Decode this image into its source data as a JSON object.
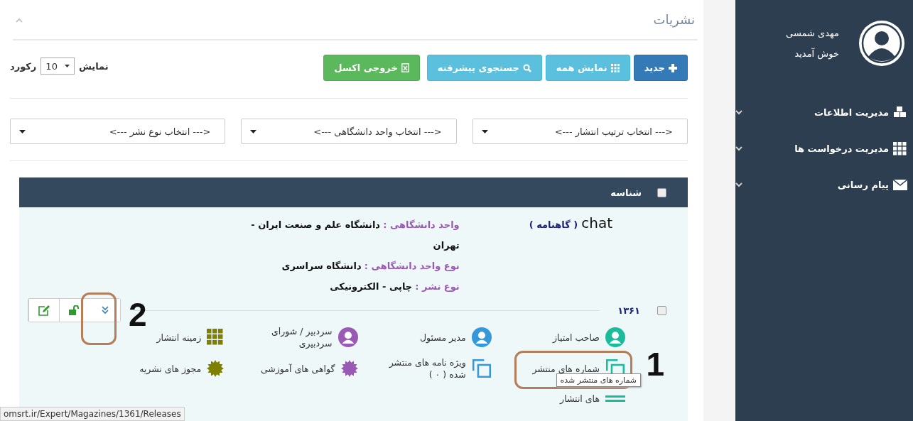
{
  "sidebar": {
    "user_name": "مهدی شمسی",
    "greeting": "خوش آمدید",
    "items": [
      {
        "label": "مدیریت اطلاعات",
        "kind": "cubes",
        "expanded": false
      },
      {
        "label": "مدیریت درخواست ها",
        "kind": "grid",
        "expanded": false
      },
      {
        "label": "پیام رسانی",
        "kind": "mail",
        "expanded": false
      }
    ]
  },
  "panel": {
    "title": "نشریات"
  },
  "toolbar": {
    "buttons": [
      {
        "label": "جدید",
        "kind": "new"
      },
      {
        "label": "نمایش همه",
        "kind": "all"
      },
      {
        "label": "جستجوی پیشرفته",
        "kind": "search"
      },
      {
        "label": "خروجی اکسل",
        "kind": "excel"
      }
    ],
    "page_size_label": "نمایش",
    "page_size": "10",
    "page_size_suffix": "رکورد"
  },
  "filters": [
    {
      "placeholder": "<--- انتخاب ترتیب انتشار --->"
    },
    {
      "placeholder": "<--- انتخاب واحد دانشگاهی --->"
    },
    {
      "placeholder": "<--- انتخاب نوع نشر --->"
    }
  ],
  "table": {
    "header": {
      "label": "شناسه",
      "checked": false
    },
    "record": {
      "checked": false,
      "id": "۱۳۶۱",
      "title": "chat",
      "period": "( گاهنامه )",
      "fields": [
        {
          "label": "واحد دانشگاهی :",
          "value": "دانشگاه علم و صنعت ایران - تهران"
        },
        {
          "label": "نوع واحد دانشگاهی :",
          "value": "دانشگاه سراسری"
        },
        {
          "label": "نوع نشر :",
          "value": "چاپی - الکترونیکی"
        }
      ],
      "actions": [
        {
          "kind": "expand",
          "annotation": "2"
        },
        {
          "kind": "unlock"
        },
        {
          "kind": "edit"
        }
      ],
      "links": [
        {
          "label": "صاحب امتیاز",
          "kind": "user",
          "color": "#1abc9c"
        },
        {
          "label": "مدیر مسئول",
          "kind": "user",
          "color": "#3498db"
        },
        {
          "label": "سردبیر / شورای سردبیری",
          "kind": "user",
          "color": "#9b59b6"
        },
        {
          "label": "زمینه انتشار",
          "kind": "grid",
          "color": "#808000"
        },
        {
          "label": "شماره های منتشر",
          "kind": "copy",
          "color": "#1abc9c",
          "annotation": "1"
        },
        {
          "label": "ویژه نامه های منتشر شده ( ۰ )",
          "kind": "copy",
          "color": "#3498db"
        },
        {
          "label": "گواهی های آموزشی",
          "kind": "badge",
          "color": "#9b59b6"
        },
        {
          "label": "مجوز های نشریه",
          "kind": "badge",
          "color": "#808000"
        },
        {
          "label": "های انتشار",
          "kind": "list",
          "color": "#1abc9c"
        }
      ]
    }
  },
  "tooltip": "شماره های منتشر شده",
  "status_url": "omsrt.ir/Expert/Magazines/1361/Releases"
}
